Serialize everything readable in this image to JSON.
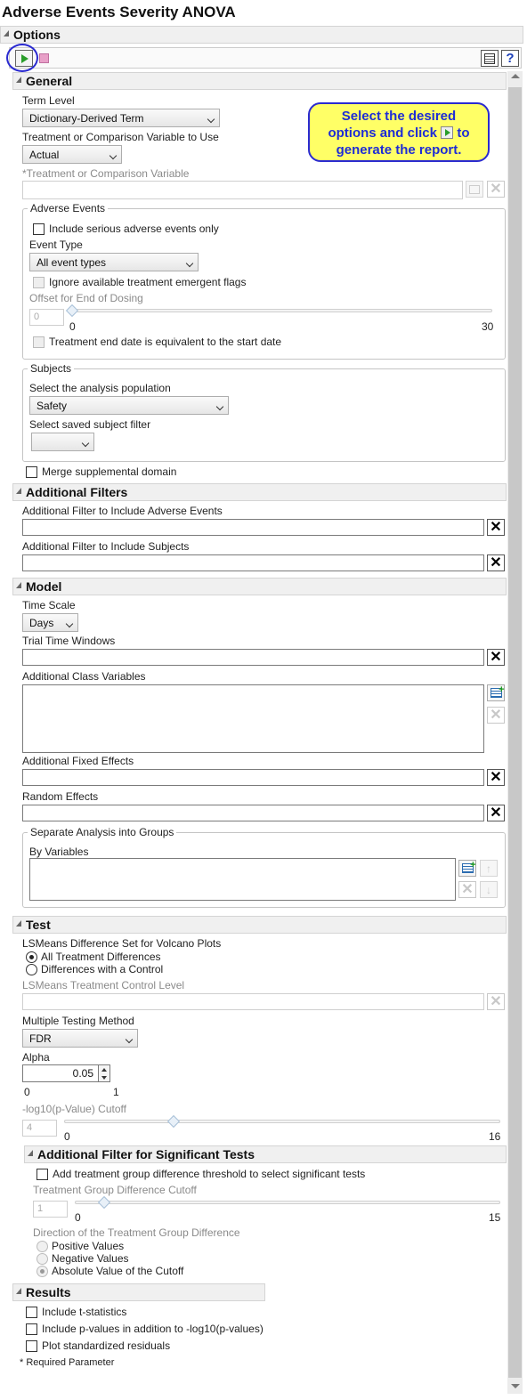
{
  "title": "Adverse Events Severity ANOVA",
  "options_header": "Options",
  "callout": {
    "line1": "Select the desired",
    "line2a": "options and click",
    "line2b": "to",
    "line3": "generate the report."
  },
  "general": {
    "header": "General",
    "term_level_label": "Term Level",
    "term_level_value": "Dictionary-Derived Term",
    "treatment_var_label": "Treatment or Comparison Variable to Use",
    "treatment_var_value": "Actual",
    "treatment_comp_label": "*Treatment or Comparison Variable",
    "adverse_events": {
      "group_label": "Adverse Events",
      "serious_only": "Include serious adverse events only",
      "event_type_label": "Event Type",
      "event_type_value": "All event types",
      "ignore_flags": "Ignore available treatment emergent flags",
      "offset_label": "Offset for End of Dosing",
      "offset_value": "0",
      "offset_min": "0",
      "offset_max": "30",
      "end_date_equiv": "Treatment end date is equivalent to the start date"
    },
    "subjects": {
      "group_label": "Subjects",
      "population_label": "Select the analysis population",
      "population_value": "Safety",
      "saved_filter_label": "Select saved subject filter",
      "saved_filter_value": ""
    },
    "merge_supp": "Merge supplemental domain"
  },
  "additional_filters": {
    "header": "Additional Filters",
    "ae_filter_label": "Additional Filter to Include Adverse Events",
    "subj_filter_label": "Additional Filter to Include Subjects"
  },
  "model": {
    "header": "Model",
    "time_scale_label": "Time Scale",
    "time_scale_value": "Days",
    "trial_windows_label": "Trial Time Windows",
    "class_vars_label": "Additional Class Variables",
    "fixed_effects_label": "Additional Fixed Effects",
    "random_effects_label": "Random Effects",
    "separate_group_label": "Separate Analysis into Groups",
    "by_variables_label": "By Variables"
  },
  "test": {
    "header": "Test",
    "lsmeans_label": "LSMeans Difference Set for Volcano Plots",
    "opt_all": "All Treatment Differences",
    "opt_control": "Differences with a Control",
    "control_level_label": "LSMeans Treatment Control Level",
    "mult_method_label": "Multiple Testing Method",
    "mult_method_value": "FDR",
    "alpha_label": "Alpha",
    "alpha_value": "0.05",
    "alpha_min": "0",
    "alpha_max": "1",
    "cutoff_label": "-log10(p-Value) Cutoff",
    "cutoff_value": "4",
    "cutoff_min": "0",
    "cutoff_max": "16"
  },
  "sig_filter": {
    "header": "Additional Filter for Significant Tests",
    "add_threshold": "Add treatment group difference threshold to select significant tests",
    "diff_cutoff_label": "Treatment Group Difference Cutoff",
    "diff_cutoff_value": "1",
    "diff_min": "0",
    "diff_max": "15",
    "direction_label": "Direction of the Treatment Group Difference",
    "positive": "Positive Values",
    "negative": "Negative Values",
    "absolute": "Absolute Value of the Cutoff"
  },
  "results": {
    "header": "Results",
    "t_stats": "Include t-statistics",
    "p_values": "Include p-values in addition to -log10(p-values)",
    "std_resid": "Plot standardized residuals"
  },
  "required_note": "* Required Parameter",
  "colors": {
    "accent": "#2a2ad0",
    "callout_bg": "#ffff66",
    "run_green": "#2a9d2a"
  }
}
